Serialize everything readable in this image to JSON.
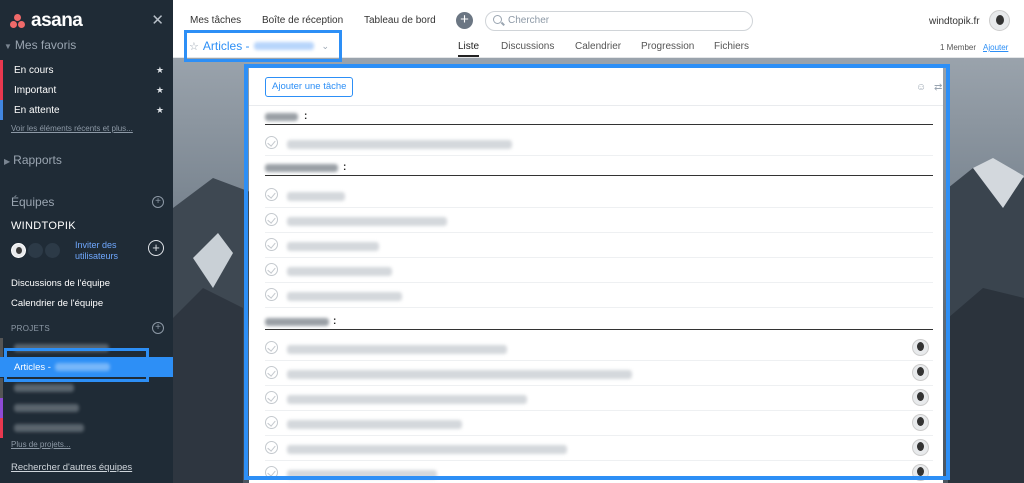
{
  "app": {
    "brand": "asana"
  },
  "sidebar": {
    "favorites_title": "Mes favoris",
    "favorites": [
      {
        "label": "En cours",
        "color": "#e8384f"
      },
      {
        "label": "Important",
        "color": "#e8384f"
      },
      {
        "label": "En attente",
        "color": "#4186e0"
      }
    ],
    "recent_link": "Voir les éléments récents et plus...",
    "reports_title": "Rapports",
    "teams_title": "Équipes",
    "team_name": "WINDTOPIK",
    "invite_line1": "Inviter des",
    "invite_line2": "utilisateurs",
    "team_discussions": "Discussions de l'équipe",
    "team_calendar": "Calendrier de l'équipe",
    "projects_label": "PROJETS",
    "active_project_label": "Articles -",
    "more_projects": "Plus de projets...",
    "search_teams": "Rechercher d'autres équipes"
  },
  "topbar": {
    "nav": [
      "Mes tâches",
      "Boîte de réception",
      "Tableau de bord"
    ],
    "search_placeholder": "Chercher",
    "user": "windtopik.fr",
    "project_title": "Articles -",
    "tabs": [
      "Liste",
      "Discussions",
      "Calendrier",
      "Progression",
      "Fichiers"
    ],
    "active_tab": "Liste",
    "members": "1 Member",
    "add_member": "Ajouter"
  },
  "panel": {
    "add_task": "Ajouter une tâche",
    "section_colon": ":"
  },
  "colors": {
    "accent": "#2d8ff6",
    "sidebar_bg": "#1f2b36"
  }
}
